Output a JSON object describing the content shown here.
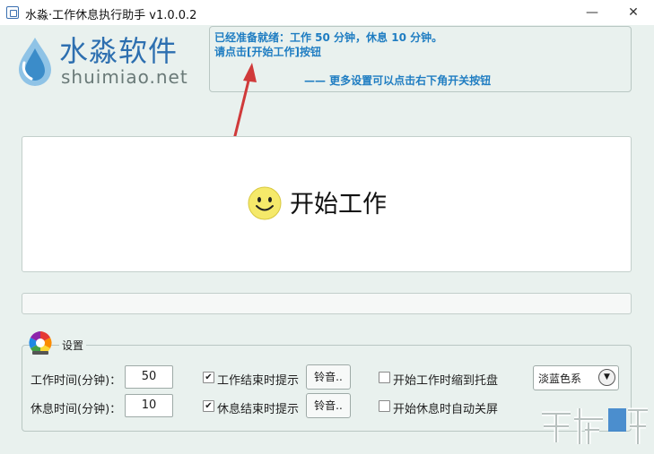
{
  "window": {
    "title": "水淼·工作休息执行助手 v1.0.0.2",
    "minimize_glyph": "—",
    "close_glyph": "✕"
  },
  "logo": {
    "name": "水淼软件",
    "url": "shuimiao.net"
  },
  "notice": {
    "line1": "已经准备就绪：工作 50 分钟，休息 10 分钟。",
    "line2": "请点击[开始工作]按钮",
    "line3": "—— 更多设置可以点击右下角开关按钮"
  },
  "main": {
    "start_label": "开始工作"
  },
  "settings": {
    "group_label": "设置",
    "work_time_label": "工作时间(分钟)：",
    "work_time_value": "50",
    "rest_time_label": "休息时间(分钟)：",
    "rest_time_value": "10",
    "work_end_tip_label": "工作结束时提示",
    "work_end_tip_checked": true,
    "rest_end_tip_label": "休息结束时提示",
    "rest_end_tip_checked": true,
    "ringtone_button": "铃音..",
    "minimize_to_tray_label": "开始工作时缩到托盘",
    "minimize_to_tray_checked": false,
    "auto_screen_off_label": "开始休息时自动关屏",
    "auto_screen_off_checked": false,
    "color_scheme_value": "淡蓝色系"
  },
  "colors": {
    "background": "#e9f1ee",
    "notice_text": "#1f7dc2",
    "arrow": "#d03a3a",
    "logo_blue": "#2d6fb0"
  }
}
